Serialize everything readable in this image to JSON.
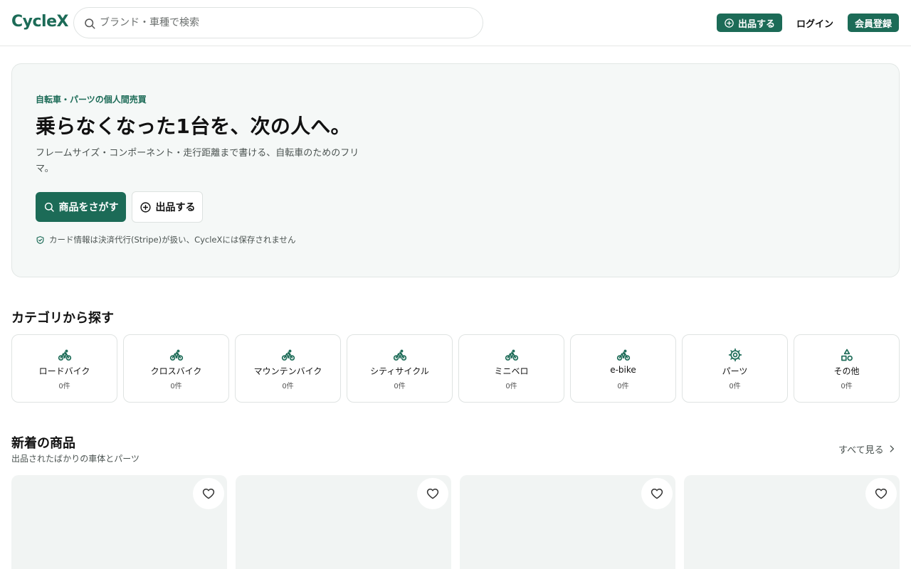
{
  "header": {
    "logo": "CycleX",
    "search_placeholder": "ブランド・車種で検索",
    "sell_label": "出品する",
    "login_label": "ログイン",
    "register_label": "会員登録"
  },
  "hero": {
    "eyebrow": "自転車・パーツの個人間売買",
    "title": "乗らなくなった1台を、次の人へ。",
    "description": "フレームサイズ・コンポーネント・走行距離まで書ける、自転車のためのフリマ。",
    "browse_label": "商品をさがす",
    "sell_label": "出品する",
    "secure_note": "カード情報は決済代行(Stripe)が扱い、CycleXには保存されません"
  },
  "categories": {
    "title": "カテゴリから探す",
    "items": [
      {
        "name": "ロードバイク",
        "count": "0件",
        "icon": "bicycle-icon"
      },
      {
        "name": "クロスバイク",
        "count": "0件",
        "icon": "bicycle-icon"
      },
      {
        "name": "マウンテンバイク",
        "count": "0件",
        "icon": "bicycle-icon"
      },
      {
        "name": "シティサイクル",
        "count": "0件",
        "icon": "bicycle-icon"
      },
      {
        "name": "ミニベロ",
        "count": "0件",
        "icon": "bicycle-icon"
      },
      {
        "name": "e-bike",
        "count": "0件",
        "icon": "bicycle-icon"
      },
      {
        "name": "パーツ",
        "count": "0件",
        "icon": "cog-icon"
      },
      {
        "name": "その他",
        "count": "0件",
        "icon": "shapes-icon"
      }
    ]
  },
  "new_items": {
    "title": "新着の商品",
    "subtitle": "出品されたばかりの車体とパーツ",
    "see_all": "すべて見る"
  },
  "colors": {
    "accent": "#1c6b57",
    "hero_bg": "#f5f8f7",
    "card_placeholder": "#f1f4f3"
  }
}
